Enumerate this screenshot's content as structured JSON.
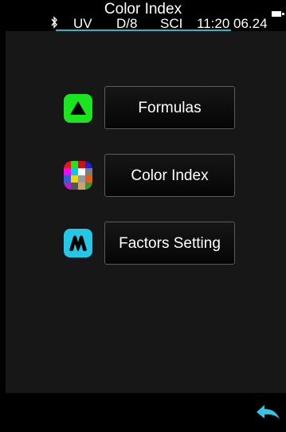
{
  "header": {
    "title": "Color Index",
    "status": {
      "bluetooth_icon": "bluetooth-icon",
      "light_source": "UV",
      "geometry": "D/8",
      "mode": "SCI",
      "clock": "11:20 06.24"
    },
    "accent_color": "#3fb0c7"
  },
  "menu": {
    "items": [
      {
        "label": "Formulas",
        "icon": "triangle-up-icon",
        "icon_color": "#19e61f"
      },
      {
        "label": "Color Index",
        "icon": "color-palette-grid-icon"
      },
      {
        "label": "Factors Setting",
        "icon": "factors-m-icon",
        "icon_color": "#22c8e6"
      }
    ]
  },
  "footer": {
    "back_icon": "back-arrow-icon",
    "back_icon_color": "#2dc6e6"
  }
}
